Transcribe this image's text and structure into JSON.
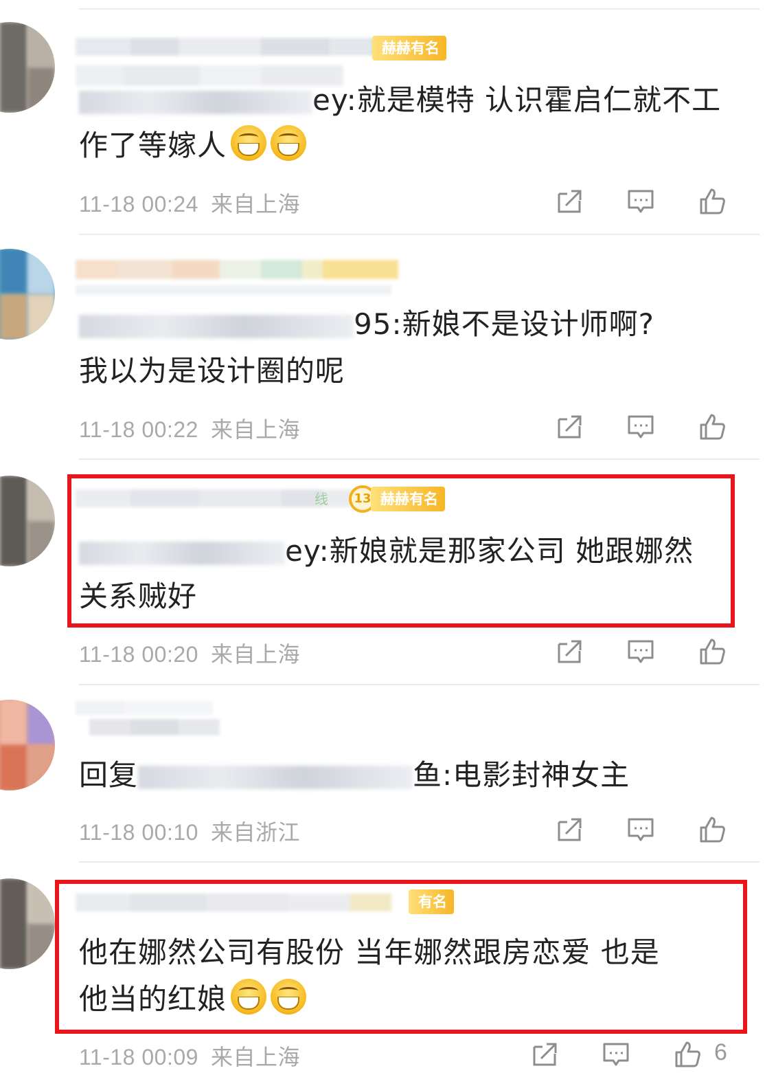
{
  "colors": {
    "highlight": "#e8151b",
    "meta": "#a9a9a9",
    "badge": "#f7b627"
  },
  "comments": [
    {
      "badge": "赫赫有名",
      "name_tail": "ey:",
      "text_line1": "就是模特 认识霍启仁就不工",
      "text_line2": "作了等嫁人",
      "emoji_count": 2,
      "time": "11-18 00:24",
      "location": "来自上海"
    },
    {
      "name_tail": "95:",
      "text_line1": "新娘不是设计师啊?",
      "text_line2": "我以为是设计圈的呢",
      "time": "11-18 00:22",
      "location": "来自上海"
    },
    {
      "tag_small": "线",
      "level": "13",
      "badge": "赫赫有名",
      "name_tail": "ey:",
      "text_line1": "新娘就是那家公司 她跟娜然",
      "text_line2": "关系贼好",
      "time": "11-18 00:20",
      "location": "来自上海"
    },
    {
      "reply_prefix": "回复",
      "name_tail": "鱼:",
      "text_line1": "电影封神女主",
      "time": "11-18 00:10",
      "location": "来自浙江"
    },
    {
      "badge": "有名",
      "text_line1": "他在娜然公司有股份 当年娜然跟房恋爱 也是",
      "text_line2": "他当的红娘",
      "emoji_count": 2,
      "time": "11-18 00:09",
      "location": "来自上海",
      "like_count": "6"
    }
  ],
  "icons": {
    "share": "share-icon",
    "comment": "comment-icon",
    "like": "thumbs-up-icon"
  }
}
